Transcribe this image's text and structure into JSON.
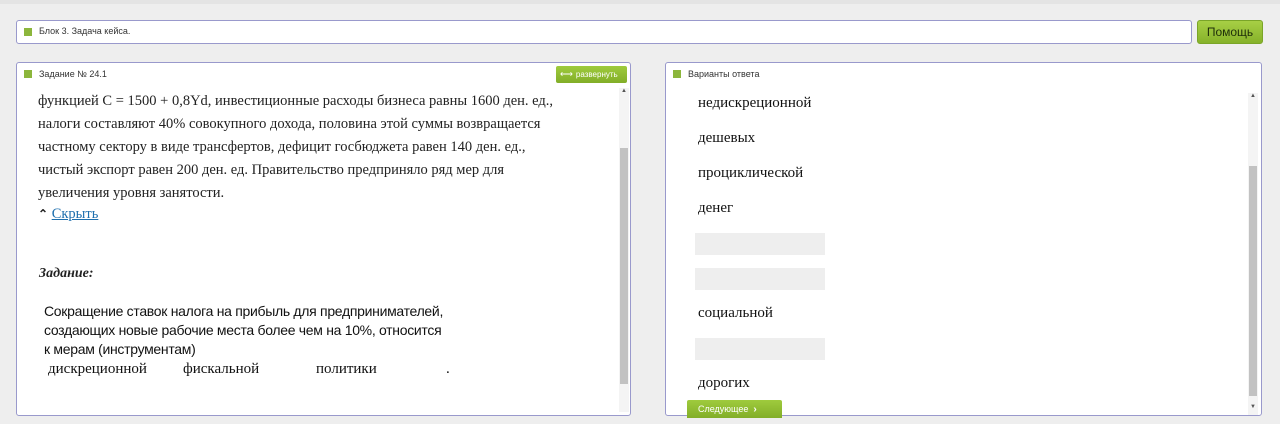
{
  "block_title": "Блок 3. Задача кейса.",
  "help_button": "Помощь",
  "task_panel": {
    "header": "Задание № 24.1",
    "expand_label": "развернуть",
    "text_lines": [
      "функцией С = 1500 + 0,8Yd, инвестиционные расходы бизнеса равны 1600 ден. ед.,",
      "налоги составляют 40% совокупного дохода, половина этой суммы возвращается",
      "частному сектору в виде трансфертов, дефицит госбюджета равен 140 ден. ед.,",
      "чистый экспорт равен 200 ден. ед. Правительство предприняло ряд мер для",
      "увеличения уровня занятости."
    ],
    "hide_link": "Скрыть",
    "task_label": "Задание:",
    "question_lines": [
      "Сокращение ставок налога на прибыль для предпринимателей,",
      "создающих новые рабочие места более чем на 10%, относится",
      "к мерам (инструментам)"
    ],
    "answer_words": [
      "дискреционной",
      "фискальной",
      "политики",
      "."
    ]
  },
  "options_panel": {
    "header": "Варианты ответа",
    "options": [
      "недискреционной",
      "дешевых",
      "проциклической",
      "денег",
      "",
      "",
      "социальной",
      "",
      "дорогих"
    ],
    "next_button": "Следующее"
  }
}
